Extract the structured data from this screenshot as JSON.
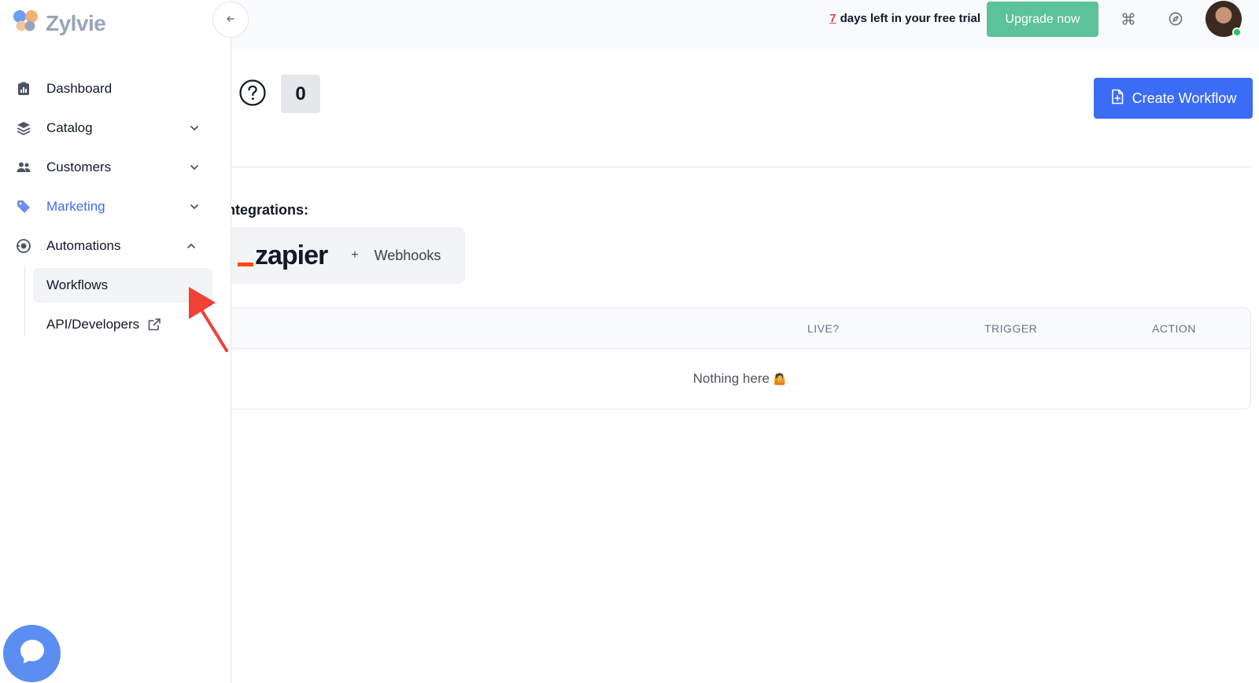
{
  "header": {
    "trial_days": "7",
    "trial_text": "days left in your free trial",
    "upgrade_label": "Upgrade now",
    "icons": [
      "command-icon",
      "compass-icon"
    ],
    "accent_upgrade": "#5cc29b"
  },
  "sidebar": {
    "brand": "Zylvie",
    "items": [
      {
        "label": "Dashboard",
        "icon": "clipboard-chart-icon"
      },
      {
        "label": "Catalog",
        "icon": "layers-icon"
      },
      {
        "label": "Customers",
        "icon": "users-icon"
      },
      {
        "label": "Marketing",
        "icon": "tag-icon"
      },
      {
        "label": "Automations",
        "icon": "automation-icon"
      }
    ],
    "sub_items": [
      {
        "label": "Workflows"
      },
      {
        "label": "API/Developers"
      }
    ]
  },
  "main": {
    "count": "0",
    "create_label": "Create Workflow",
    "integrations_label": "ntegrations:",
    "zapier_logo": "zapier",
    "plus": "+",
    "webhooks": "Webhooks",
    "table": {
      "columns": [
        "LIVE?",
        "TRIGGER",
        "ACTION"
      ],
      "empty_text": "Nothing here",
      "empty_emoji": "🤷"
    },
    "accent_primary": "#3b6cf6"
  }
}
